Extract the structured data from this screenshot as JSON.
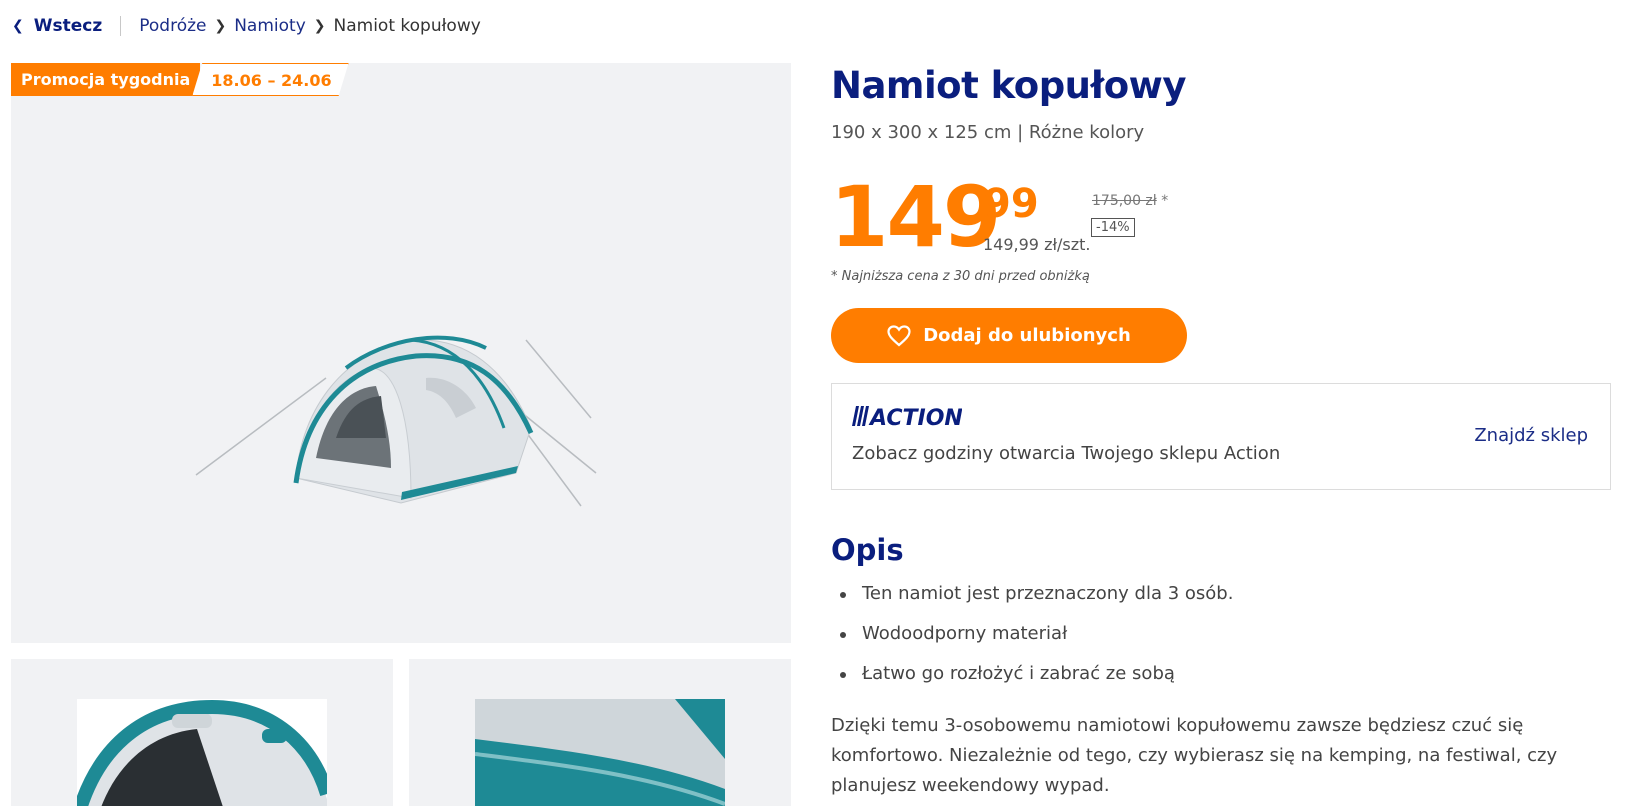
{
  "breadcrumb": {
    "back_label": "Wstecz",
    "items": [
      "Podróże",
      "Namioty"
    ],
    "current": "Namiot kopułowy"
  },
  "promo": {
    "label": "Promocja tygodnia",
    "dates": "18.06 – 24.06"
  },
  "product": {
    "title": "Namiot kopułowy",
    "subtitle": "190 x 300 x 125 cm | Różne kolory",
    "price_main": "149",
    "price_cents": "99",
    "price_unit": "149,99 zł/szt.",
    "old_price": "175,00 zł",
    "old_price_mark": "*",
    "discount": "-14%",
    "lowest_note": "* Najniższa cena z 30 dni przed obniżką"
  },
  "favorite_button": {
    "label": "Dodaj do ulubionych",
    "icon": "heart-icon"
  },
  "store": {
    "logo_text": "ACTION",
    "text": "Zobacz godziny otwarcia Twojego sklepu Action",
    "find_label": "Znajdź sklep"
  },
  "description": {
    "heading": "Opis",
    "bullets": [
      "Ten namiot jest przeznaczony dla 3 osób.",
      "Wodoodporny materiał",
      "Łatwo go rozłożyć i zabrać ze sobą"
    ],
    "paragraph": "Dzięki temu 3-osobowemu namiotowi kopułowemu zawsze będziesz czuć się komfortowo. Niezależnie od tego, czy wybierasz się na kemping, na festiwal, czy planujesz weekendowy wypad."
  },
  "colors": {
    "brand_blue": "#0a1e7e",
    "accent_orange": "#ff7d00",
    "image_bg": "#f1f2f4"
  }
}
